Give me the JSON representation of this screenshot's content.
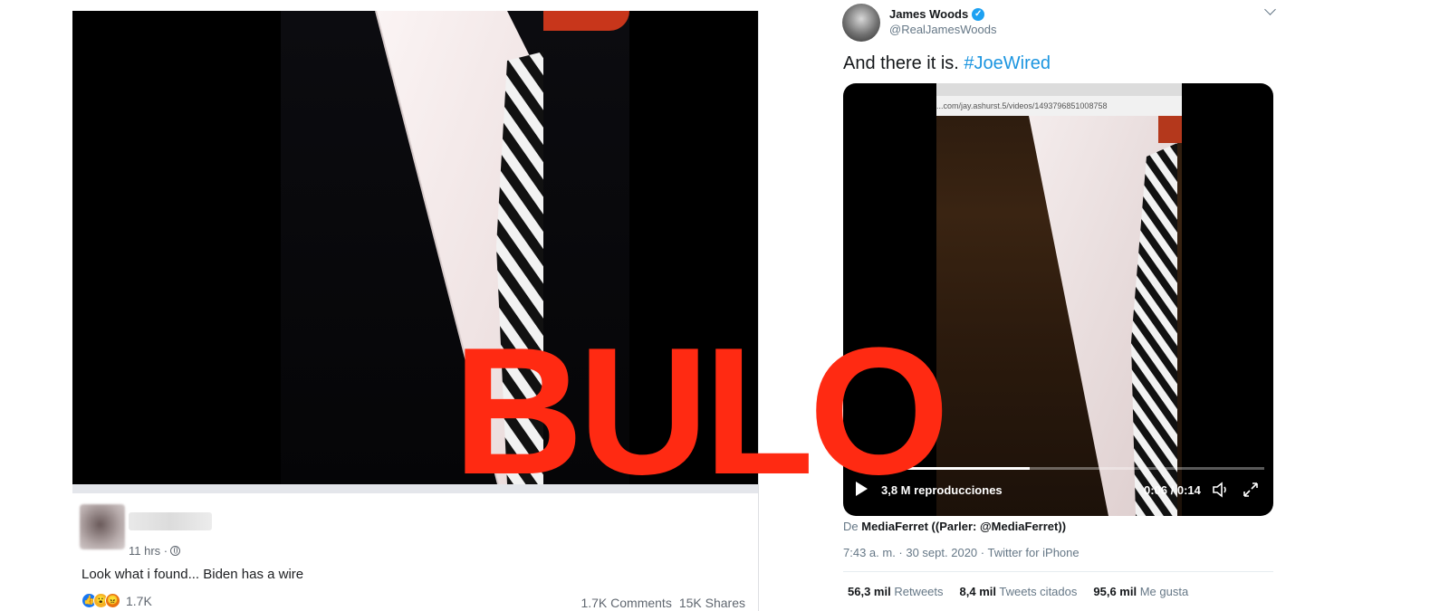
{
  "facebook_post": {
    "time": "11 hrs ·",
    "text": "Look what i found... Biden has a wire",
    "reaction_count": "1.7K",
    "comments": "1.7K Comments",
    "shares": "15K Shares",
    "reaction_icons": [
      "like-icon",
      "wow-icon",
      "angry-icon"
    ],
    "colors": {
      "like": "#1877f2",
      "wow": "#f7b125",
      "angry": "#e9710f"
    }
  },
  "tweet": {
    "name": "James Woods",
    "handle": "@RealJamesWoods",
    "text": "And there it is. ",
    "hashtag": "#JoeWired",
    "video": {
      "url_text": "...com/jay.ashurst.5/videos/1493796851008758",
      "views": "3,8 M reproducciones",
      "time": "0:06 / 0:14",
      "progress": 0.43
    },
    "source_prefix": "De ",
    "source_name": "MediaFerret ((Parler: @MediaFerret))",
    "date": "7:43 a. m. · 30 sept. 2020 · Twitter for iPhone",
    "stats": {
      "retweets_count": "56,3 mil",
      "retweets_label": "Retweets",
      "quotes_count": "8,4 mil",
      "quotes_label": "Tweets citados",
      "likes_count": "95,6 mil",
      "likes_label": "Me gusta"
    },
    "colors": {
      "link": "#1b95e0",
      "verified": "#1da1f2"
    }
  },
  "stamp": {
    "text": "BULO",
    "color": "#ff2a12"
  }
}
